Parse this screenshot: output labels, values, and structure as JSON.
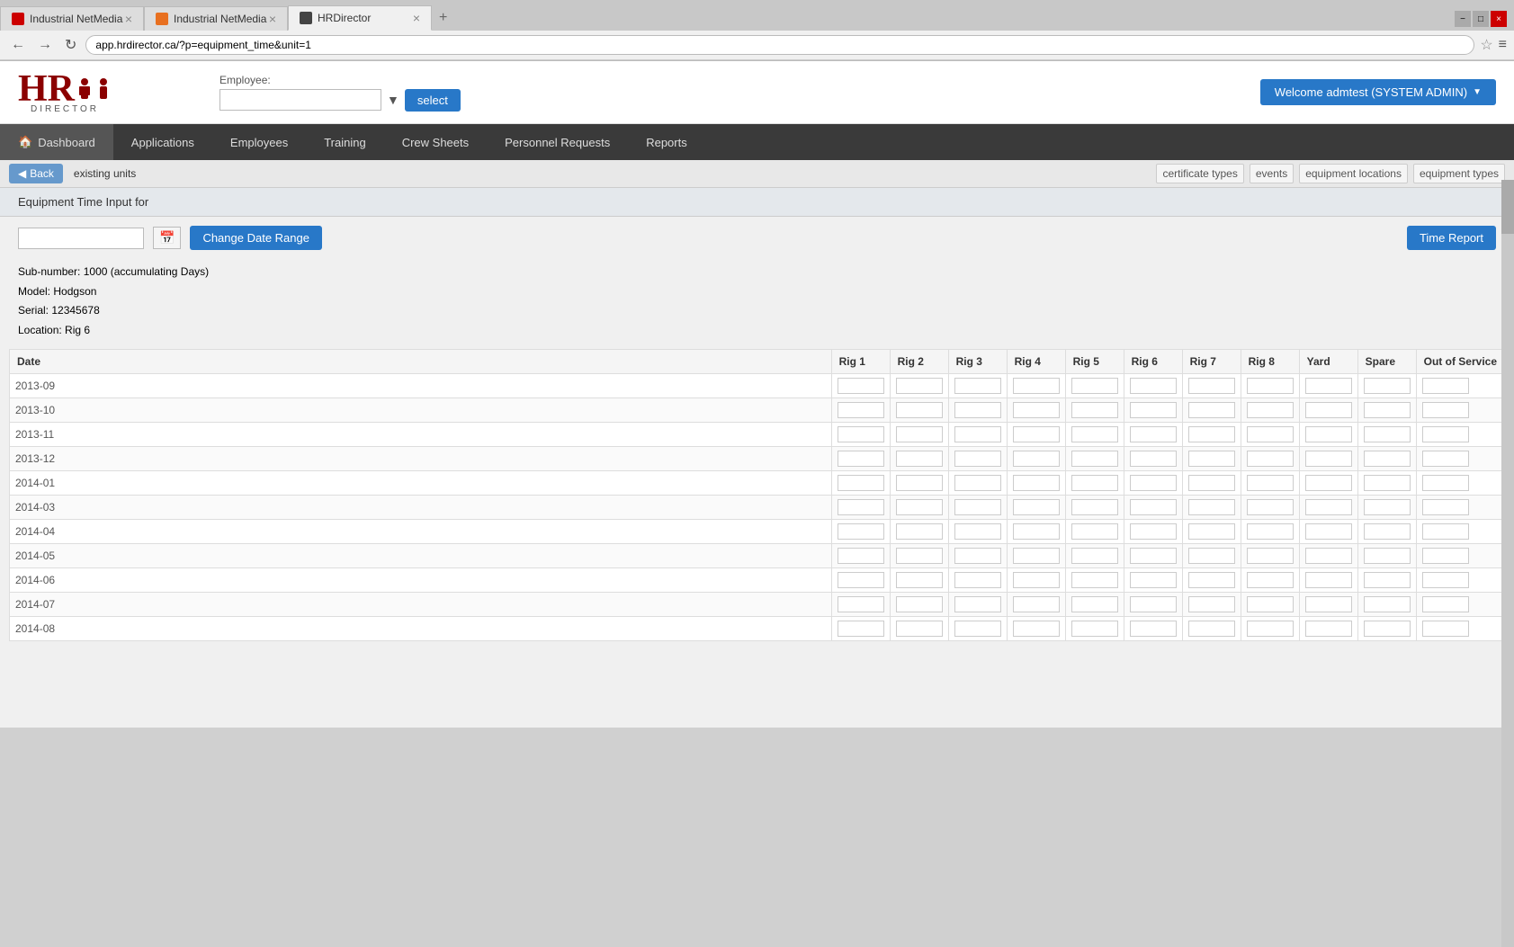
{
  "browser": {
    "tabs": [
      {
        "label": "Industrial NetMedia",
        "favicon": "red",
        "active": false
      },
      {
        "label": "Industrial NetMedia",
        "favicon": "orange",
        "active": false
      },
      {
        "label": "HRDirector",
        "favicon": "dark",
        "active": true
      }
    ],
    "url": "app.hrdirector.ca/?p=equipment_time&unit=1"
  },
  "header": {
    "logo_hr": "HR",
    "logo_director": "DIRECTOR",
    "employee_label": "Employee:",
    "employee_placeholder": "",
    "select_button": "select",
    "welcome_button": "Welcome admtest (SYSTEM ADMIN)"
  },
  "nav": {
    "items": [
      {
        "label": "Dashboard",
        "icon": "🏠",
        "active": true
      },
      {
        "label": "Applications",
        "icon": ""
      },
      {
        "label": "Employees",
        "icon": ""
      },
      {
        "label": "Training",
        "icon": ""
      },
      {
        "label": "Crew Sheets",
        "icon": ""
      },
      {
        "label": "Personnel Requests",
        "icon": ""
      },
      {
        "label": "Reports",
        "icon": ""
      }
    ]
  },
  "subnav": {
    "back_label": "◀ Back",
    "existing_units_label": "existing units",
    "right_links": [
      "certificate types",
      "events",
      "equipment locations",
      "equipment types"
    ]
  },
  "content": {
    "header_label": "Equipment Time Input for",
    "toolbar": {
      "date_value": "",
      "change_date_label": "Change Date Range",
      "time_report_label": "Time Report"
    },
    "unit_info": {
      "sub_number_label": "Sub-number:",
      "sub_number_value": "1000 (accumulating Days)",
      "model_label": "Model:",
      "model_value": "Hodgson",
      "serial_label": "Serial:",
      "serial_value": "12345678",
      "location_label": "Location:",
      "location_value": "Rig 6"
    },
    "table": {
      "columns": [
        "Date",
        "Rig 1",
        "Rig 2",
        "Rig 3",
        "Rig 4",
        "Rig 5",
        "Rig 6",
        "Rig 7",
        "Rig 8",
        "Yard",
        "Spare",
        "Out of Service"
      ],
      "rows": [
        {
          "date": "2013-09"
        },
        {
          "date": "2013-10"
        },
        {
          "date": "2013-11"
        },
        {
          "date": "2013-12"
        },
        {
          "date": "2014-01"
        },
        {
          "date": "2014-03"
        },
        {
          "date": "2014-04"
        },
        {
          "date": "2014-05"
        },
        {
          "date": "2014-06"
        },
        {
          "date": "2014-07"
        },
        {
          "date": "2014-08"
        }
      ]
    }
  }
}
